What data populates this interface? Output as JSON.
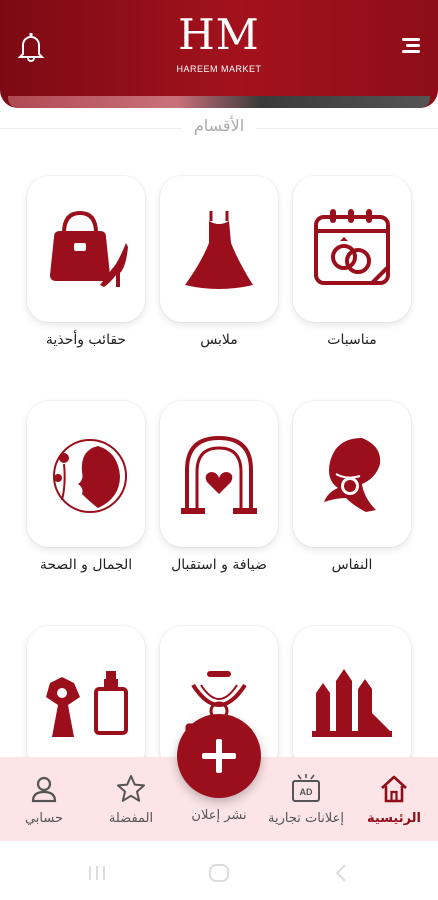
{
  "header": {
    "logo_mark": "HM",
    "logo_text": "HAREEM MARKET",
    "bell_icon": "bell-icon",
    "menu_icon": "menu-icon",
    "brand_color": "#9a0f1b"
  },
  "section": {
    "title": "الأقسام"
  },
  "categories": [
    {
      "label": "مناسبات",
      "icon": "calendar-rings-icon"
    },
    {
      "label": "ملابس",
      "icon": "dress-icon"
    },
    {
      "label": "حقائب وأحذية",
      "icon": "bag-heel-icon"
    },
    {
      "label": "النفاس",
      "icon": "mother-baby-icon"
    },
    {
      "label": "ضيافة و استقبال",
      "icon": "heart-arch-icon"
    },
    {
      "label": "الجمال و الصحة",
      "icon": "beauty-face-icon"
    },
    {
      "label": "",
      "icon": "bouncy-castle-icon"
    },
    {
      "label": "",
      "icon": "jewelry-icon"
    },
    {
      "label": "",
      "icon": "perfume-dress-icon"
    }
  ],
  "nav": {
    "home": "الرئيسية",
    "ads": "إعلانات تجارية",
    "ads_badge": "AD",
    "post": "نشر إعلان",
    "favorites": "المفضلة",
    "account": "حسابي",
    "active_color": "#8e0d18"
  }
}
